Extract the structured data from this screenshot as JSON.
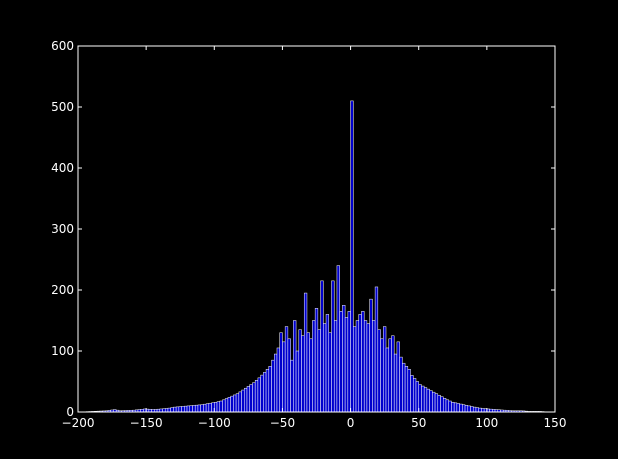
{
  "chart_data": {
    "type": "bar",
    "title": "",
    "xlabel": "",
    "ylabel": "",
    "xlim": [
      -200,
      150
    ],
    "ylim": [
      0,
      600
    ],
    "grid": false,
    "bar_color": "#0000cd",
    "edge_color": "#ffffff",
    "background": "#000000",
    "bin_width": 2,
    "xticks": [
      -200,
      -150,
      -100,
      -50,
      0,
      50,
      100,
      150
    ],
    "yticks": [
      0,
      100,
      200,
      300,
      400,
      500,
      600
    ],
    "xtick_labels": [
      "−200",
      "−150",
      "−100",
      "−50",
      "0",
      "50",
      "100",
      "150"
    ],
    "ytick_labels": [
      "0",
      "100",
      "200",
      "300",
      "400",
      "500",
      "600"
    ],
    "bins": [
      {
        "x": -200,
        "y": 0
      },
      {
        "x": -190,
        "y": 1
      },
      {
        "x": -180,
        "y": 2
      },
      {
        "x": -174,
        "y": 4
      },
      {
        "x": -170,
        "y": 2
      },
      {
        "x": -160,
        "y": 3
      },
      {
        "x": -152,
        "y": 5
      },
      {
        "x": -145,
        "y": 4
      },
      {
        "x": -140,
        "y": 5
      },
      {
        "x": -135,
        "y": 6
      },
      {
        "x": -130,
        "y": 8
      },
      {
        "x": -125,
        "y": 9
      },
      {
        "x": -120,
        "y": 10
      },
      {
        "x": -115,
        "y": 11
      },
      {
        "x": -110,
        "y": 12
      },
      {
        "x": -105,
        "y": 14
      },
      {
        "x": -100,
        "y": 16
      },
      {
        "x": -96,
        "y": 18
      },
      {
        "x": -92,
        "y": 22
      },
      {
        "x": -88,
        "y": 26
      },
      {
        "x": -84,
        "y": 30
      },
      {
        "x": -80,
        "y": 36
      },
      {
        "x": -76,
        "y": 42
      },
      {
        "x": -72,
        "y": 48
      },
      {
        "x": -68,
        "y": 56
      },
      {
        "x": -64,
        "y": 65
      },
      {
        "x": -60,
        "y": 75
      },
      {
        "x": -56,
        "y": 95
      },
      {
        "x": -54,
        "y": 105
      },
      {
        "x": -52,
        "y": 130
      },
      {
        "x": -50,
        "y": 115
      },
      {
        "x": -48,
        "y": 140
      },
      {
        "x": -46,
        "y": 120
      },
      {
        "x": -44,
        "y": 85
      },
      {
        "x": -42,
        "y": 150
      },
      {
        "x": -40,
        "y": 100
      },
      {
        "x": -38,
        "y": 135
      },
      {
        "x": -36,
        "y": 125
      },
      {
        "x": -34,
        "y": 195
      },
      {
        "x": -32,
        "y": 130
      },
      {
        "x": -30,
        "y": 120
      },
      {
        "x": -28,
        "y": 150
      },
      {
        "x": -26,
        "y": 170
      },
      {
        "x": -24,
        "y": 135
      },
      {
        "x": -22,
        "y": 215
      },
      {
        "x": -20,
        "y": 145
      },
      {
        "x": -18,
        "y": 160
      },
      {
        "x": -16,
        "y": 130
      },
      {
        "x": -14,
        "y": 215
      },
      {
        "x": -12,
        "y": 150
      },
      {
        "x": -10,
        "y": 240
      },
      {
        "x": -8,
        "y": 165
      },
      {
        "x": -6,
        "y": 175
      },
      {
        "x": -4,
        "y": 155
      },
      {
        "x": -2,
        "y": 165
      },
      {
        "x": 0,
        "y": 510
      },
      {
        "x": 2,
        "y": 140
      },
      {
        "x": 4,
        "y": 150
      },
      {
        "x": 6,
        "y": 160
      },
      {
        "x": 8,
        "y": 165
      },
      {
        "x": 10,
        "y": 150
      },
      {
        "x": 12,
        "y": 145
      },
      {
        "x": 14,
        "y": 185
      },
      {
        "x": 16,
        "y": 150
      },
      {
        "x": 18,
        "y": 205
      },
      {
        "x": 20,
        "y": 135
      },
      {
        "x": 22,
        "y": 120
      },
      {
        "x": 24,
        "y": 140
      },
      {
        "x": 26,
        "y": 105
      },
      {
        "x": 28,
        "y": 120
      },
      {
        "x": 30,
        "y": 125
      },
      {
        "x": 32,
        "y": 95
      },
      {
        "x": 34,
        "y": 115
      },
      {
        "x": 36,
        "y": 90
      },
      {
        "x": 38,
        "y": 80
      },
      {
        "x": 40,
        "y": 75
      },
      {
        "x": 42,
        "y": 70
      },
      {
        "x": 44,
        "y": 60
      },
      {
        "x": 46,
        "y": 55
      },
      {
        "x": 48,
        "y": 50
      },
      {
        "x": 50,
        "y": 45
      },
      {
        "x": 54,
        "y": 40
      },
      {
        "x": 58,
        "y": 35
      },
      {
        "x": 62,
        "y": 30
      },
      {
        "x": 66,
        "y": 25
      },
      {
        "x": 70,
        "y": 20
      },
      {
        "x": 74,
        "y": 16
      },
      {
        "x": 78,
        "y": 14
      },
      {
        "x": 82,
        "y": 12
      },
      {
        "x": 86,
        "y": 10
      },
      {
        "x": 90,
        "y": 8
      },
      {
        "x": 95,
        "y": 6
      },
      {
        "x": 100,
        "y": 5
      },
      {
        "x": 106,
        "y": 4
      },
      {
        "x": 112,
        "y": 3
      },
      {
        "x": 118,
        "y": 2
      },
      {
        "x": 125,
        "y": 2
      },
      {
        "x": 130,
        "y": 1
      },
      {
        "x": 138,
        "y": 1
      },
      {
        "x": 145,
        "y": 0
      }
    ]
  }
}
